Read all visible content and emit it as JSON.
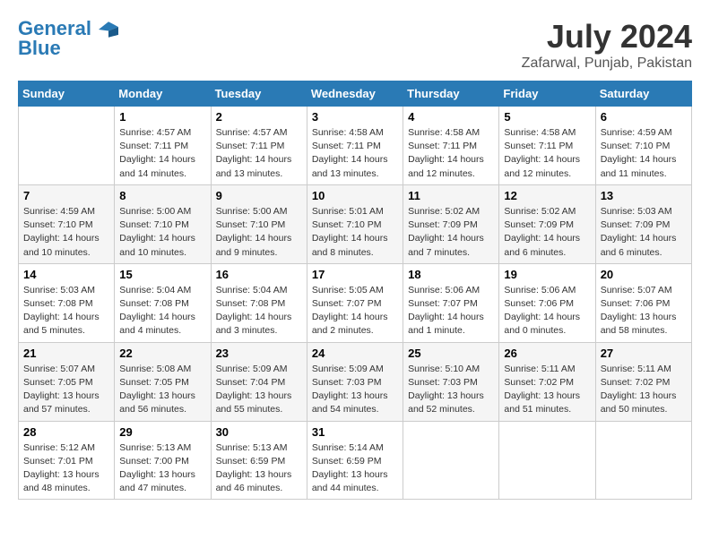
{
  "header": {
    "logo_line1": "General",
    "logo_line2": "Blue",
    "month_title": "July 2024",
    "location": "Zafarwal, Punjab, Pakistan"
  },
  "weekdays": [
    "Sunday",
    "Monday",
    "Tuesday",
    "Wednesday",
    "Thursday",
    "Friday",
    "Saturday"
  ],
  "weeks": [
    [
      {
        "day": "",
        "sunrise": "",
        "sunset": "",
        "daylight": ""
      },
      {
        "day": "1",
        "sunrise": "Sunrise: 4:57 AM",
        "sunset": "Sunset: 7:11 PM",
        "daylight": "Daylight: 14 hours and 14 minutes."
      },
      {
        "day": "2",
        "sunrise": "Sunrise: 4:57 AM",
        "sunset": "Sunset: 7:11 PM",
        "daylight": "Daylight: 14 hours and 13 minutes."
      },
      {
        "day": "3",
        "sunrise": "Sunrise: 4:58 AM",
        "sunset": "Sunset: 7:11 PM",
        "daylight": "Daylight: 14 hours and 13 minutes."
      },
      {
        "day": "4",
        "sunrise": "Sunrise: 4:58 AM",
        "sunset": "Sunset: 7:11 PM",
        "daylight": "Daylight: 14 hours and 12 minutes."
      },
      {
        "day": "5",
        "sunrise": "Sunrise: 4:58 AM",
        "sunset": "Sunset: 7:11 PM",
        "daylight": "Daylight: 14 hours and 12 minutes."
      },
      {
        "day": "6",
        "sunrise": "Sunrise: 4:59 AM",
        "sunset": "Sunset: 7:10 PM",
        "daylight": "Daylight: 14 hours and 11 minutes."
      }
    ],
    [
      {
        "day": "7",
        "sunrise": "Sunrise: 4:59 AM",
        "sunset": "Sunset: 7:10 PM",
        "daylight": "Daylight: 14 hours and 10 minutes."
      },
      {
        "day": "8",
        "sunrise": "Sunrise: 5:00 AM",
        "sunset": "Sunset: 7:10 PM",
        "daylight": "Daylight: 14 hours and 10 minutes."
      },
      {
        "day": "9",
        "sunrise": "Sunrise: 5:00 AM",
        "sunset": "Sunset: 7:10 PM",
        "daylight": "Daylight: 14 hours and 9 minutes."
      },
      {
        "day": "10",
        "sunrise": "Sunrise: 5:01 AM",
        "sunset": "Sunset: 7:10 PM",
        "daylight": "Daylight: 14 hours and 8 minutes."
      },
      {
        "day": "11",
        "sunrise": "Sunrise: 5:02 AM",
        "sunset": "Sunset: 7:09 PM",
        "daylight": "Daylight: 14 hours and 7 minutes."
      },
      {
        "day": "12",
        "sunrise": "Sunrise: 5:02 AM",
        "sunset": "Sunset: 7:09 PM",
        "daylight": "Daylight: 14 hours and 6 minutes."
      },
      {
        "day": "13",
        "sunrise": "Sunrise: 5:03 AM",
        "sunset": "Sunset: 7:09 PM",
        "daylight": "Daylight: 14 hours and 6 minutes."
      }
    ],
    [
      {
        "day": "14",
        "sunrise": "Sunrise: 5:03 AM",
        "sunset": "Sunset: 7:08 PM",
        "daylight": "Daylight: 14 hours and 5 minutes."
      },
      {
        "day": "15",
        "sunrise": "Sunrise: 5:04 AM",
        "sunset": "Sunset: 7:08 PM",
        "daylight": "Daylight: 14 hours and 4 minutes."
      },
      {
        "day": "16",
        "sunrise": "Sunrise: 5:04 AM",
        "sunset": "Sunset: 7:08 PM",
        "daylight": "Daylight: 14 hours and 3 minutes."
      },
      {
        "day": "17",
        "sunrise": "Sunrise: 5:05 AM",
        "sunset": "Sunset: 7:07 PM",
        "daylight": "Daylight: 14 hours and 2 minutes."
      },
      {
        "day": "18",
        "sunrise": "Sunrise: 5:06 AM",
        "sunset": "Sunset: 7:07 PM",
        "daylight": "Daylight: 14 hours and 1 minute."
      },
      {
        "day": "19",
        "sunrise": "Sunrise: 5:06 AM",
        "sunset": "Sunset: 7:06 PM",
        "daylight": "Daylight: 14 hours and 0 minutes."
      },
      {
        "day": "20",
        "sunrise": "Sunrise: 5:07 AM",
        "sunset": "Sunset: 7:06 PM",
        "daylight": "Daylight: 13 hours and 58 minutes."
      }
    ],
    [
      {
        "day": "21",
        "sunrise": "Sunrise: 5:07 AM",
        "sunset": "Sunset: 7:05 PM",
        "daylight": "Daylight: 13 hours and 57 minutes."
      },
      {
        "day": "22",
        "sunrise": "Sunrise: 5:08 AM",
        "sunset": "Sunset: 7:05 PM",
        "daylight": "Daylight: 13 hours and 56 minutes."
      },
      {
        "day": "23",
        "sunrise": "Sunrise: 5:09 AM",
        "sunset": "Sunset: 7:04 PM",
        "daylight": "Daylight: 13 hours and 55 minutes."
      },
      {
        "day": "24",
        "sunrise": "Sunrise: 5:09 AM",
        "sunset": "Sunset: 7:03 PM",
        "daylight": "Daylight: 13 hours and 54 minutes."
      },
      {
        "day": "25",
        "sunrise": "Sunrise: 5:10 AM",
        "sunset": "Sunset: 7:03 PM",
        "daylight": "Daylight: 13 hours and 52 minutes."
      },
      {
        "day": "26",
        "sunrise": "Sunrise: 5:11 AM",
        "sunset": "Sunset: 7:02 PM",
        "daylight": "Daylight: 13 hours and 51 minutes."
      },
      {
        "day": "27",
        "sunrise": "Sunrise: 5:11 AM",
        "sunset": "Sunset: 7:02 PM",
        "daylight": "Daylight: 13 hours and 50 minutes."
      }
    ],
    [
      {
        "day": "28",
        "sunrise": "Sunrise: 5:12 AM",
        "sunset": "Sunset: 7:01 PM",
        "daylight": "Daylight: 13 hours and 48 minutes."
      },
      {
        "day": "29",
        "sunrise": "Sunrise: 5:13 AM",
        "sunset": "Sunset: 7:00 PM",
        "daylight": "Daylight: 13 hours and 47 minutes."
      },
      {
        "day": "30",
        "sunrise": "Sunrise: 5:13 AM",
        "sunset": "Sunset: 6:59 PM",
        "daylight": "Daylight: 13 hours and 46 minutes."
      },
      {
        "day": "31",
        "sunrise": "Sunrise: 5:14 AM",
        "sunset": "Sunset: 6:59 PM",
        "daylight": "Daylight: 13 hours and 44 minutes."
      },
      {
        "day": "",
        "sunrise": "",
        "sunset": "",
        "daylight": ""
      },
      {
        "day": "",
        "sunrise": "",
        "sunset": "",
        "daylight": ""
      },
      {
        "day": "",
        "sunrise": "",
        "sunset": "",
        "daylight": ""
      }
    ]
  ]
}
